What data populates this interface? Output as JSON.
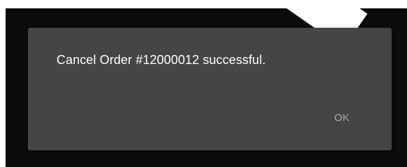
{
  "dialog": {
    "message": "Cancel Order #12000012 successful.",
    "ok_label": "OK"
  },
  "colors": {
    "scrim": "#0b0b0b",
    "dialog_background": "#454545",
    "message_text": "#ffffff",
    "button_text": "#a7a7a7"
  }
}
